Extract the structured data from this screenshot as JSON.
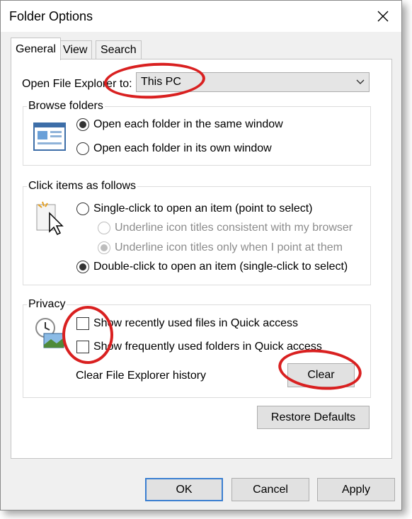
{
  "window": {
    "title": "Folder Options"
  },
  "tabs": [
    "General",
    "View",
    "Search"
  ],
  "open_explorer": {
    "label": "Open File Explorer to:",
    "value": "This PC"
  },
  "browse": {
    "legend": "Browse folders",
    "options": [
      "Open each folder in the same window",
      "Open each folder in its own window"
    ]
  },
  "click_items": {
    "legend": "Click items as follows",
    "single_click": "Single-click to open an item (point to select)",
    "underline_browser": "Underline icon titles consistent with my browser",
    "underline_point": "Underline icon titles only when I point at them",
    "double_click": "Double-click to open an item (single-click to select)"
  },
  "privacy": {
    "legend": "Privacy",
    "recent_files": "Show recently used files in Quick access",
    "frequent_folders": "Show frequently used folders in Quick access",
    "clear_history_label": "Clear File Explorer history",
    "clear_button": "Clear"
  },
  "restore_defaults": "Restore Defaults",
  "footer": {
    "ok": "OK",
    "cancel": "Cancel",
    "apply": "Apply"
  },
  "colors": {
    "annotation_ring": "#d92020",
    "default_button_border": "#3b7fd1"
  }
}
